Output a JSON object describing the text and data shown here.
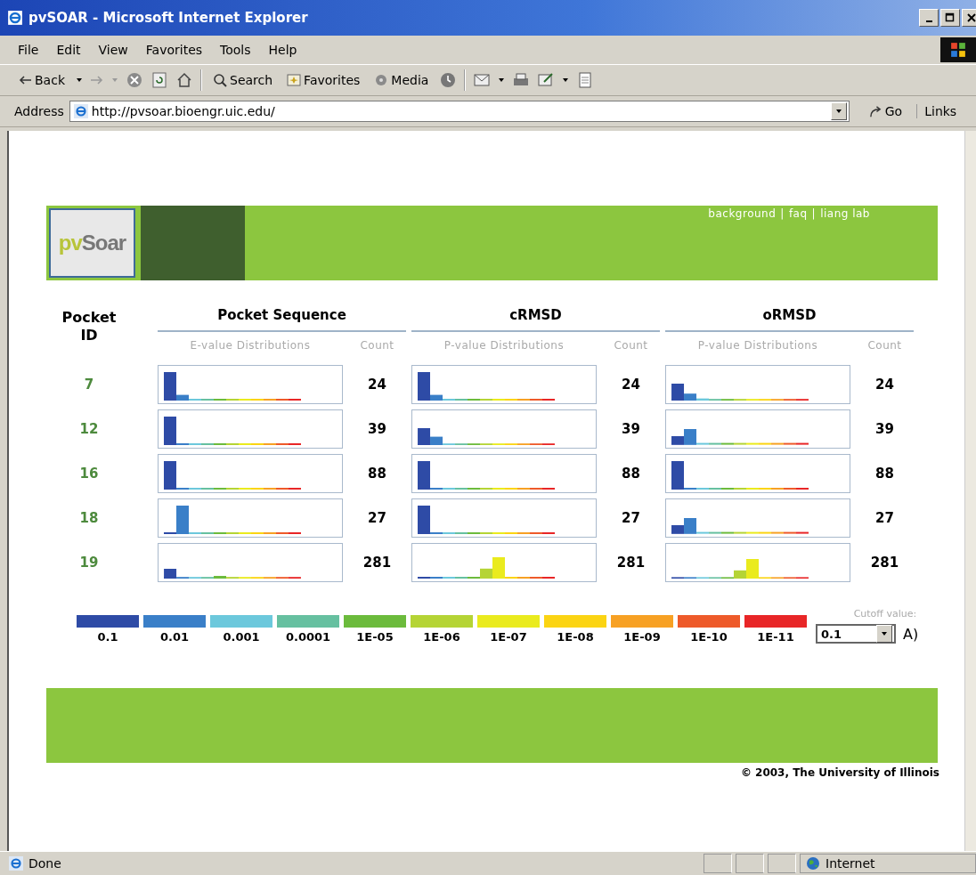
{
  "window": {
    "title": "pvSOAR - Microsoft Internet Explorer"
  },
  "menu_bar": [
    "File",
    "Edit",
    "View",
    "Favorites",
    "Tools",
    "Help"
  ],
  "toolbar": {
    "back": "Back",
    "search": "Search",
    "favorites": "Favorites",
    "media": "Media"
  },
  "address_bar": {
    "label": "Address",
    "url": "http://pvsoar.bioengr.uic.edu/",
    "go": "Go",
    "links": "Links"
  },
  "banner": {
    "logo_prefix": "pv",
    "logo_name": "Soar",
    "separator": "|",
    "nav_links": [
      "background",
      "faq",
      "liang lab"
    ]
  },
  "table": {
    "id_header": "Pocket ID",
    "groups": [
      {
        "title": "Pocket Sequence",
        "dist_label": "E-value Distributions",
        "count_label": "Count"
      },
      {
        "title": "cRMSD",
        "dist_label": "P-value Distributions",
        "count_label": "Count"
      },
      {
        "title": "oRMSD",
        "dist_label": "P-value Distributions",
        "count_label": "Count"
      }
    ],
    "rows": [
      {
        "id": "7",
        "counts": [
          "24",
          "24",
          "24"
        ]
      },
      {
        "id": "12",
        "counts": [
          "39",
          "39",
          "39"
        ]
      },
      {
        "id": "16",
        "counts": [
          "88",
          "88",
          "88"
        ]
      },
      {
        "id": "18",
        "counts": [
          "27",
          "27",
          "27"
        ]
      },
      {
        "id": "19",
        "counts": [
          "281",
          "281",
          "281"
        ]
      }
    ]
  },
  "legend": [
    {
      "label": "0.1",
      "color": "#2e4ba6"
    },
    {
      "label": "0.01",
      "color": "#3a7fc8"
    },
    {
      "label": "0.001",
      "color": "#6cc8dc"
    },
    {
      "label": "0.0001",
      "color": "#66c0a0"
    },
    {
      "label": "1E-05",
      "color": "#6cbb3c"
    },
    {
      "label": "1E-06",
      "color": "#b5d435"
    },
    {
      "label": "1E-07",
      "color": "#eaeb1e"
    },
    {
      "label": "1E-08",
      "color": "#fbd413"
    },
    {
      "label": "1E-09",
      "color": "#f7a124"
    },
    {
      "label": "1E-10",
      "color": "#ee5a2a"
    },
    {
      "label": "1E-11",
      "color": "#e82627"
    }
  ],
  "cutoff": {
    "label": "Cutoff value:",
    "value": "0.1"
  },
  "panel_label": "A)",
  "footer": {
    "copyright": "© 2003, The University of Illinois"
  },
  "status_bar": {
    "text": "Done",
    "zone": "Internet"
  }
}
